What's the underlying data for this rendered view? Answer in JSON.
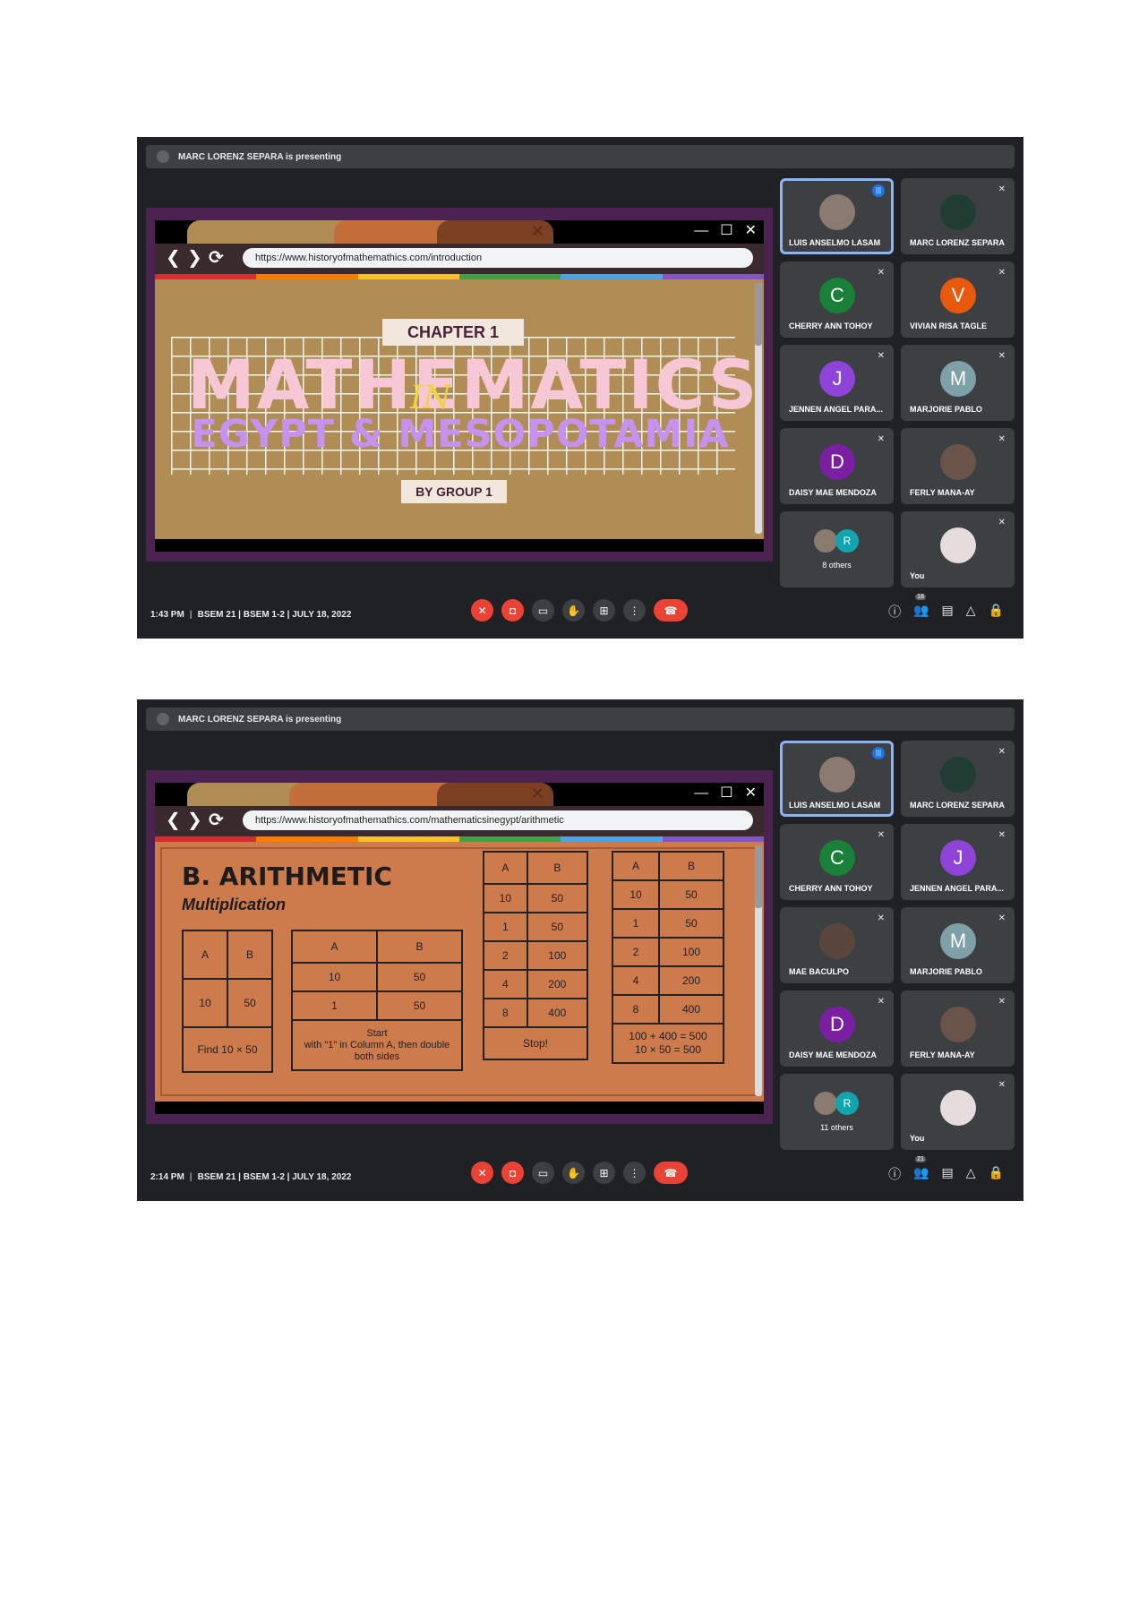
{
  "shot1": {
    "presenting": "MARC LORENZ SEPARA is presenting",
    "url": "https://www.historyofmathemathics.com/introduction",
    "slide": {
      "chapter": "CHAPTER 1",
      "title": "MATHEMATICS",
      "in_word": "IN",
      "subtitle": "EGYPT & MESOPOTAMIA",
      "byline": "BY GROUP 1"
    },
    "time": "1:43 PM",
    "meeting": "BSEM 21 | BSEM 1-2 | JULY 18, 2022",
    "people_count": "18",
    "tiles": [
      {
        "name": "LUIS ANSELMO LASAM"
      },
      {
        "name": "MARC LORENZ SEPARA"
      },
      {
        "name": "CHERRY ANN TOHOY",
        "initial": "C"
      },
      {
        "name": "VIVIAN RISA TAGLE",
        "initial": "V"
      },
      {
        "name": "JENNEN ANGEL PARA...",
        "initial": "J"
      },
      {
        "name": "MARJORIE PABLO",
        "initial": "M"
      },
      {
        "name": "DAISY MAE MENDOZA",
        "initial": "D"
      },
      {
        "name": "FERLY MANA-AY"
      },
      {
        "name": "8 others",
        "initial": "R"
      },
      {
        "name": "You"
      }
    ]
  },
  "shot2": {
    "presenting": "MARC LORENZ SEPARA is presenting",
    "url": "https://www.historyofmathemathics.com/mathematicsinegypt/arithmetic",
    "slide": {
      "heading": "B. ARITHMETIC",
      "subheading": "Multiplication",
      "t1": {
        "a": "A",
        "b": "B",
        "r1a": "10",
        "r1b": "50",
        "foot": "Find 10 × 50"
      },
      "t2": {
        "a": "A",
        "b": "B",
        "r1a": "10",
        "r1b": "50",
        "r2a": "1",
        "r2b": "50",
        "foot_1": "Start",
        "foot_2": "with \"1\" in Column A, then double both sides"
      },
      "t3": {
        "a": "A",
        "b": "B",
        "rows": [
          [
            "10",
            "50"
          ],
          [
            "1",
            "50"
          ],
          [
            "2",
            "100"
          ],
          [
            "4",
            "200"
          ],
          [
            "8",
            "400"
          ]
        ],
        "foot": "Stop!"
      },
      "t4": {
        "a": "A",
        "b": "B",
        "rows": [
          [
            "10",
            "50"
          ],
          [
            "1",
            "50"
          ],
          [
            "2",
            "100"
          ],
          [
            "4",
            "200"
          ],
          [
            "8",
            "400"
          ]
        ],
        "foot_1": "100 + 400  = 500",
        "foot_2": "10 × 50 = 500"
      }
    },
    "time": "2:14 PM",
    "meeting": "BSEM 21 | BSEM 1-2 | JULY 18, 2022",
    "people_count": "21",
    "tiles": [
      {
        "name": "LUIS ANSELMO LASAM"
      },
      {
        "name": "MARC LORENZ SEPARA"
      },
      {
        "name": "CHERRY ANN TOHOY",
        "initial": "C"
      },
      {
        "name": "JENNEN ANGEL PARA...",
        "initial": "J"
      },
      {
        "name": "MAE BACULPO"
      },
      {
        "name": "MARJORIE PABLO",
        "initial": "M"
      },
      {
        "name": "DAISY MAE MENDOZA",
        "initial": "D"
      },
      {
        "name": "FERLY MANA-AY"
      },
      {
        "name": "11 others",
        "initial": "R"
      },
      {
        "name": "You"
      }
    ]
  },
  "colors": {
    "green": "#188038",
    "orange": "#e8590c",
    "purple": "#8e44d6",
    "teal": "#7fa0a6",
    "daisy": "#7b1fa2",
    "red": "#ea4335",
    "accent": "#8ab4f8"
  }
}
